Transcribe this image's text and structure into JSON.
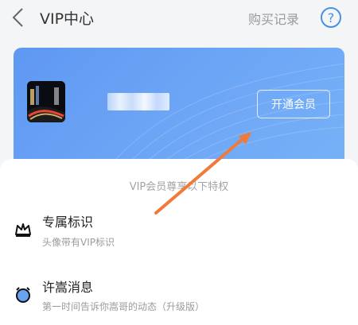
{
  "header": {
    "back_icon": "back-chevron-icon",
    "title": "VIP中心",
    "records_label": "购买记录",
    "help_label": "?"
  },
  "card": {
    "avatar": "user-avatar-city-night",
    "join_button_label": "开通会员"
  },
  "perks": {
    "header": "VIP会员尊享以下特权",
    "items": [
      {
        "icon": "crown-icon",
        "title": "专属标识",
        "description": "头像带有VIP标识"
      },
      {
        "icon": "alarm-clock-icon",
        "title": "许嵩消息",
        "description": "第一时间告诉你嵩哥的动态（升级版）"
      }
    ]
  },
  "colors": {
    "card_blue": "#6ea6f6",
    "accent_blue": "#4a90e2",
    "annotation_arrow": "#f07a3a"
  }
}
